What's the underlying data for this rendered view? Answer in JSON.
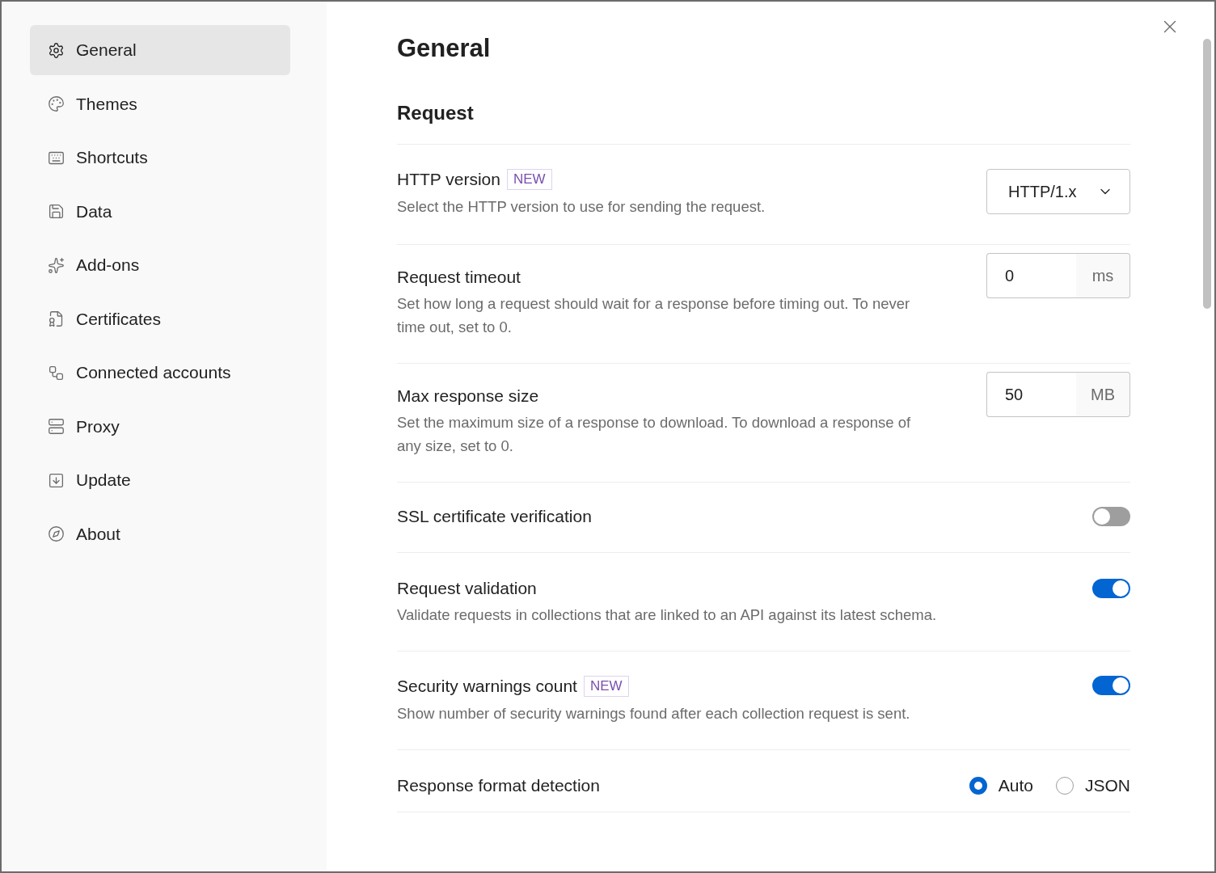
{
  "sidebar": {
    "items": [
      {
        "label": "General",
        "selected": true
      },
      {
        "label": "Themes",
        "selected": false
      },
      {
        "label": "Shortcuts",
        "selected": false
      },
      {
        "label": "Data",
        "selected": false
      },
      {
        "label": "Add-ons",
        "selected": false
      },
      {
        "label": "Certificates",
        "selected": false
      },
      {
        "label": "Connected accounts",
        "selected": false
      },
      {
        "label": "Proxy",
        "selected": false
      },
      {
        "label": "Update",
        "selected": false
      },
      {
        "label": "About",
        "selected": false
      }
    ]
  },
  "page": {
    "title": "General",
    "section": "Request"
  },
  "settings": [
    {
      "kind": "select",
      "title": "HTTP version",
      "badge": "NEW",
      "description": "Select the HTTP version to use for sending the request.",
      "value": "HTTP/1.x"
    },
    {
      "kind": "number",
      "title": "Request timeout",
      "description": "Set how long a request should wait for a response before timing out. To never time out, set to 0.",
      "value": "0",
      "unit": "ms"
    },
    {
      "kind": "number",
      "title": "Max response size",
      "description": "Set the maximum size of a response to download. To download a response of any size, set to 0.",
      "value": "50",
      "unit": "MB"
    },
    {
      "kind": "toggle",
      "title": "SSL certificate verification",
      "on": false
    },
    {
      "kind": "toggle",
      "title": "Request validation",
      "description": "Validate requests in collections that are linked to an API against its latest schema.",
      "on": true
    },
    {
      "kind": "toggle",
      "title": "Security warnings count",
      "badge": "NEW",
      "description": "Show number of security warnings found after each collection request is sent.",
      "on": true
    },
    {
      "kind": "radio",
      "title": "Response format detection",
      "options": [
        {
          "label": "Auto",
          "selected": true
        },
        {
          "label": "JSON",
          "selected": false
        }
      ]
    }
  ]
}
